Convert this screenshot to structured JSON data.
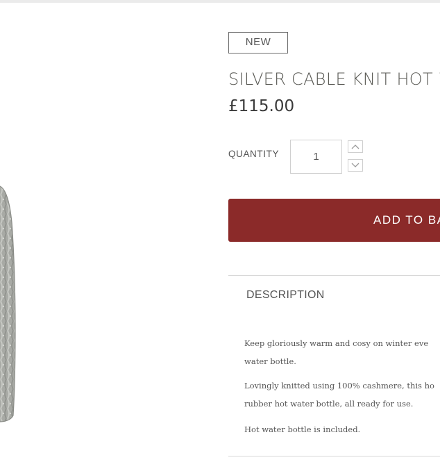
{
  "product": {
    "badge": "NEW",
    "title": "SILVER CABLE KNIT HOT W",
    "price": "£115.00"
  },
  "quantity": {
    "label": "QUANTITY",
    "value": "1",
    "increase_icon": "chevron-up-icon",
    "decrease_icon": "chevron-down-icon"
  },
  "actions": {
    "add_to_bag_label": "ADD TO BA"
  },
  "description": {
    "heading": "DESCRIPTION",
    "paragraphs": [
      [
        "Keep gloriously warm and cosy on winter eve",
        "water bottle."
      ],
      [
        "Lovingly knitted using 100% cashmere, this ho",
        "rubber hot water bottle, all ready for use."
      ],
      [
        "Hot water bottle is included."
      ]
    ]
  },
  "colors": {
    "accent": "#8b2a29",
    "knit": "#a9aba6"
  }
}
